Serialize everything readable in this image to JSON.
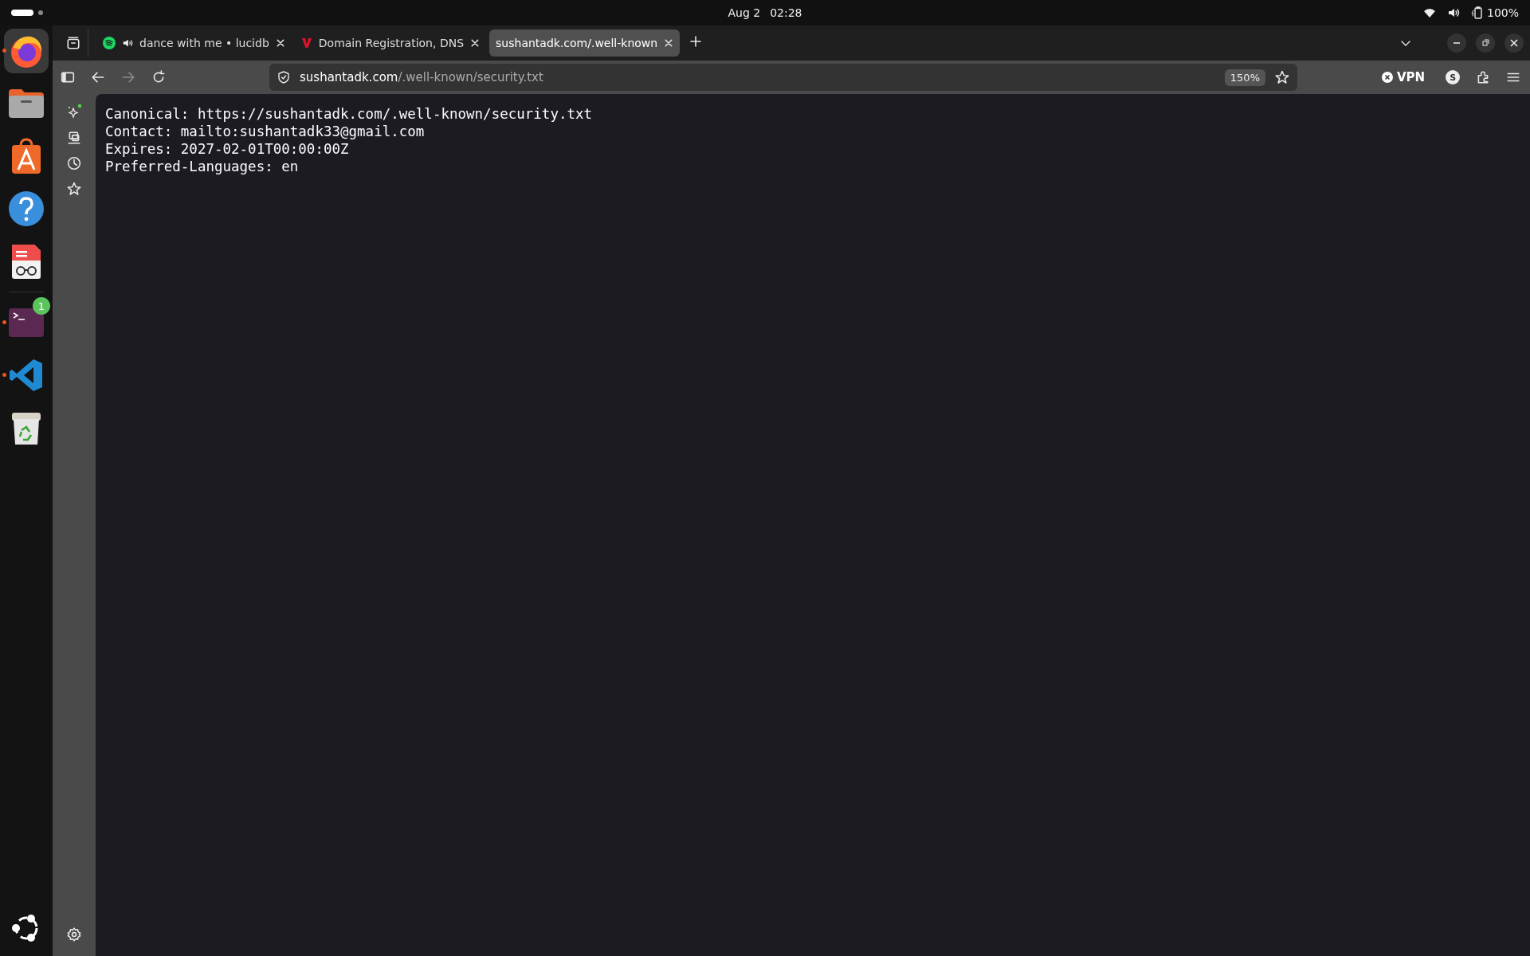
{
  "top_bar": {
    "date": "Aug 2",
    "time": "02:28",
    "battery": "100%"
  },
  "dock": [
    {
      "kind": "firefox",
      "running": true,
      "selected": true
    },
    {
      "kind": "files",
      "running": false,
      "selected": false
    },
    {
      "kind": "store",
      "running": false,
      "selected": false
    },
    {
      "kind": "help",
      "running": false,
      "selected": false
    },
    {
      "kind": "reader",
      "running": false,
      "selected": false
    },
    {
      "kind": "terminal",
      "running": true,
      "selected": false,
      "badge": "1"
    },
    {
      "kind": "code",
      "running": true,
      "selected": false
    },
    {
      "kind": "trash",
      "running": false,
      "selected": false
    }
  ],
  "tabs": [
    {
      "kind": "music",
      "title": "dance with me • lucidb",
      "playing": true,
      "selected": false
    },
    {
      "kind": "registrar",
      "title": "Domain Registration, DNS",
      "playing": false,
      "selected": false
    },
    {
      "kind": "page",
      "title": "sushantadk.com/.well-known",
      "playing": false,
      "selected": true
    }
  ],
  "address_bar": {
    "domain": "sushantadk.com",
    "path": "/.well-known/security.txt",
    "zoom": "150%"
  },
  "toolbar": {
    "vpn": "VPN",
    "account": "S"
  },
  "document": {
    "lines": [
      "Canonical: https://sushantadk.com/.well-known/security.txt",
      "Contact: mailto:sushantadk33@gmail.com",
      "Expires: 2027-02-01T00:00:00Z",
      "Preferred-Languages: en"
    ]
  }
}
